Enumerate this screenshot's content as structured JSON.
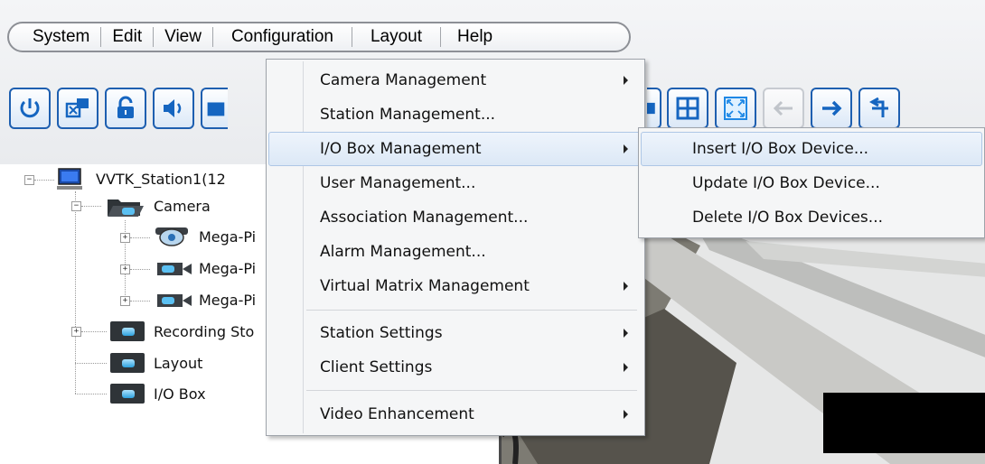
{
  "menubar": {
    "items": [
      "System",
      "Edit",
      "View",
      "Configuration",
      "Layout",
      "Help"
    ]
  },
  "toolbar": {
    "left_buttons": [
      "power-icon",
      "station-icon",
      "lock-icon",
      "speaker-icon",
      "folder-icon"
    ],
    "right_buttons": [
      "screen-icon",
      "grid-icon",
      "fullscreen-icon",
      "arrow-left-icon",
      "arrow-right-icon",
      "exit-icon"
    ],
    "disabled": [
      "arrow-left-icon"
    ]
  },
  "tree": {
    "root": "VVTK_Station1(12",
    "camera_folder": "Camera",
    "cameras": [
      "Mega-Pi",
      "Mega-Pi",
      "Mega-Pi"
    ],
    "recording": "Recording Sto",
    "layout": "Layout",
    "io_box": "I/O Box"
  },
  "configuration_menu": {
    "items": [
      {
        "label": "Camera Management",
        "submenu": true
      },
      {
        "label": "Station Management...",
        "submenu": false
      },
      {
        "label": "I/O Box Management",
        "submenu": true,
        "highlighted": true
      },
      {
        "label": "User Management...",
        "submenu": false
      },
      {
        "label": "Association Management...",
        "submenu": false
      },
      {
        "label": "Alarm Management...",
        "submenu": false
      },
      {
        "label": "Virtual Matrix Management",
        "submenu": true
      },
      {
        "label": "Station Settings",
        "submenu": true
      },
      {
        "label": "Client Settings",
        "submenu": true
      },
      {
        "label": "Video Enhancement",
        "submenu": true
      }
    ]
  },
  "io_submenu": {
    "items": [
      {
        "label": "Insert I/O Box Device...",
        "highlighted": true
      },
      {
        "label": "Update I/O Box Device..."
      },
      {
        "label": "Delete I/O Box Devices..."
      }
    ]
  },
  "colors": {
    "accent": "#1e5fb0",
    "highlight": "#dce8f6",
    "menu_bg": "#f5f6f7"
  }
}
